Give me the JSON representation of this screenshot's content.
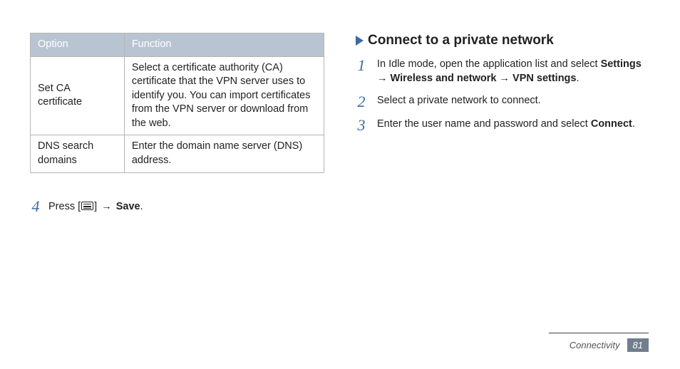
{
  "table": {
    "head": {
      "c1": "Option",
      "c2": "Function"
    },
    "rows": [
      {
        "c1": "Set CA certificate",
        "c2": "Select a certificate authority (CA) certificate that the VPN server uses to identify you. You can import certificates from the VPN server or download from the web."
      },
      {
        "c1": "DNS search domains",
        "c2": "Enter the domain name server (DNS) address."
      }
    ]
  },
  "left_step": {
    "num": "4",
    "pre": "Press [",
    "post": "] ",
    "arrow": "→",
    "save": "Save",
    "tail": "."
  },
  "right": {
    "heading": "Connect to a private network",
    "steps": [
      {
        "num": "1",
        "text_a": "In Idle mode, open the application list and select ",
        "b1": "Settings",
        "arrow1": " → ",
        "b2": "Wireless and network",
        "arrow2": " → ",
        "b3": "VPN settings",
        "tail": "."
      },
      {
        "num": "2",
        "text_a": "Select a private network to connect."
      },
      {
        "num": "3",
        "text_a": "Enter the user name and password and select ",
        "b1": "Connect",
        "tail": "."
      }
    ]
  },
  "footer": {
    "section": "Connectivity",
    "page": "81"
  }
}
